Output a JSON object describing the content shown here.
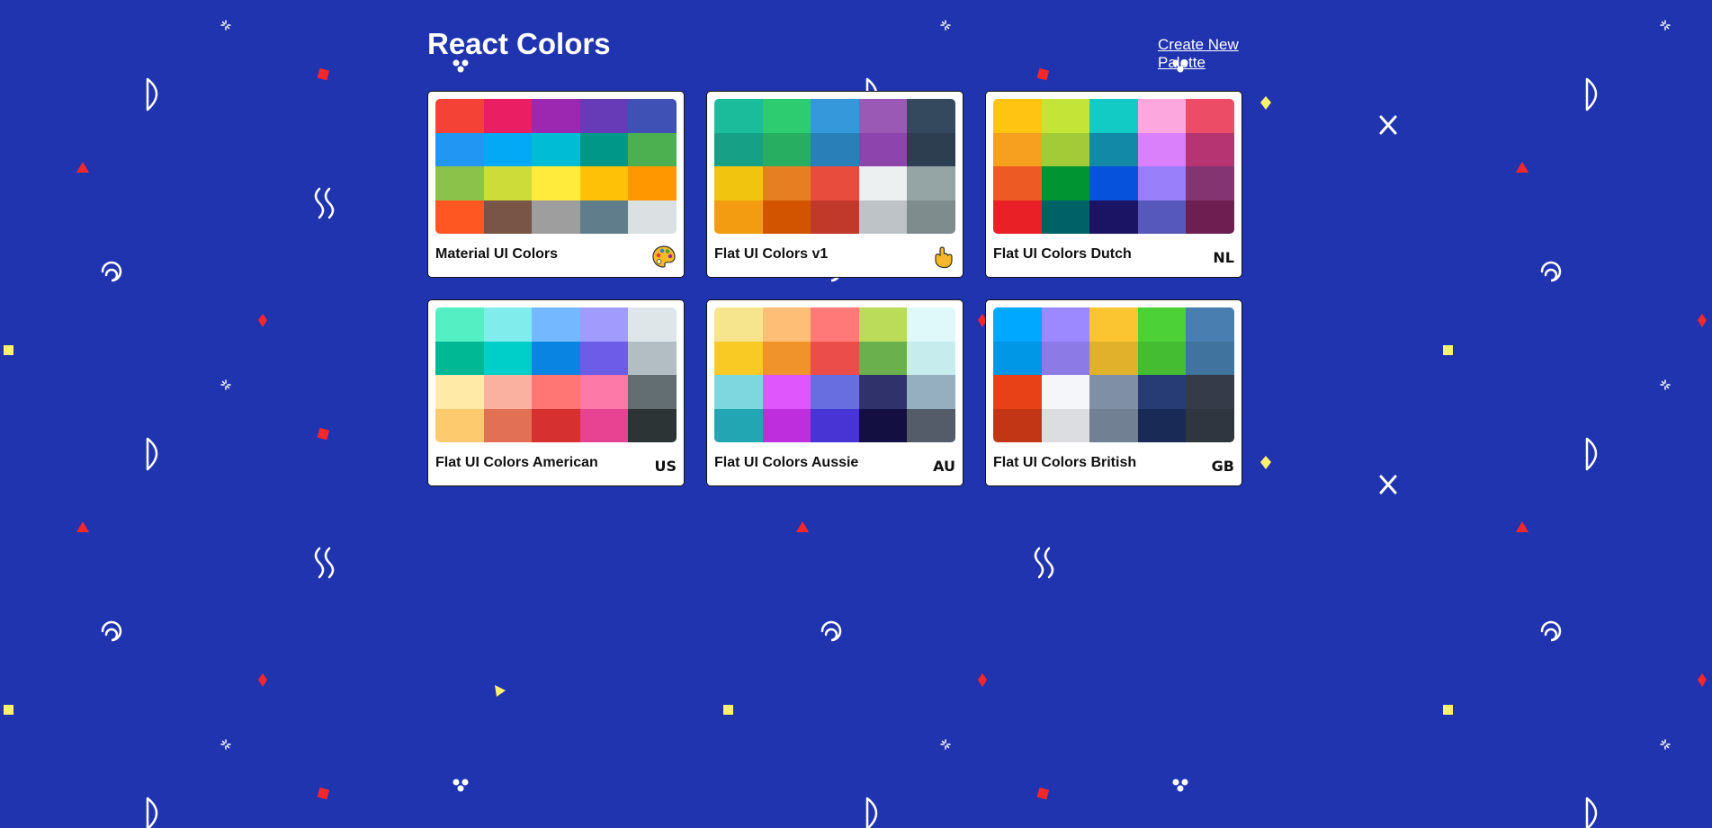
{
  "header": {
    "title": "React Colors",
    "create_link": "Create New Palette"
  },
  "theme": {
    "background": "#2034b0",
    "pattern_white": "#ffffff",
    "pattern_red": "#f4272b",
    "pattern_yellow": "#fef16d"
  },
  "palettes": [
    {
      "name": "Material UI Colors",
      "emoji_kind": "palette-icon",
      "emoji_text": "",
      "colors": [
        "#f44336",
        "#e91e63",
        "#9c27b0",
        "#673ab7",
        "#3f51b5",
        "#2196f3",
        "#03a9f4",
        "#00bcd4",
        "#009688",
        "#4caf50",
        "#8bc34a",
        "#cddc39",
        "#ffeb3b",
        "#ffc107",
        "#ff9800",
        "#ff5722",
        "#795548",
        "#9e9e9e",
        "#607d8b",
        "#dbe0e3"
      ]
    },
    {
      "name": "Flat UI Colors v1",
      "emoji_kind": "hand-icon",
      "emoji_text": "",
      "colors": [
        "#1abc9c",
        "#2ecc71",
        "#3498db",
        "#9b59b6",
        "#34495e",
        "#16a085",
        "#27ae60",
        "#2980b9",
        "#8e44ad",
        "#2c3e50",
        "#f1c40f",
        "#e67e22",
        "#e74c3c",
        "#ecf0f1",
        "#95a5a6",
        "#f39c12",
        "#d35400",
        "#c0392b",
        "#bdc3c7",
        "#7f8c8d"
      ]
    },
    {
      "name": "Flat UI Colors Dutch",
      "emoji_kind": "flag-code",
      "emoji_text": "NL",
      "colors": [
        "#ffc312",
        "#c4e538",
        "#12cbc4",
        "#fda7df",
        "#ed4c67",
        "#f79f1f",
        "#a3cb38",
        "#1289a7",
        "#d980fa",
        "#b53471",
        "#ee5a24",
        "#009432",
        "#0652dd",
        "#9980fa",
        "#833471",
        "#ea2027",
        "#006266",
        "#1b1464",
        "#5758bb",
        "#6f1e51"
      ]
    },
    {
      "name": "Flat UI Colors American",
      "emoji_kind": "flag-code",
      "emoji_text": "US",
      "colors": [
        "#55efc4",
        "#81ecec",
        "#74b9ff",
        "#a29bfe",
        "#dfe6e9",
        "#00b894",
        "#00cec9",
        "#0984e3",
        "#6c5ce7",
        "#b2bec3",
        "#ffeaa7",
        "#fab1a0",
        "#ff7675",
        "#fd79a8",
        "#636e72",
        "#fdcb6e",
        "#e17055",
        "#d63031",
        "#e84393",
        "#2d3436"
      ]
    },
    {
      "name": "Flat UI Colors Aussie",
      "emoji_kind": "flag-code",
      "emoji_text": "AU",
      "colors": [
        "#f6e58d",
        "#ffbe76",
        "#ff7979",
        "#badc58",
        "#dff9fb",
        "#f9ca24",
        "#f0932b",
        "#eb4d4b",
        "#6ab04c",
        "#c7ecee",
        "#7ed6df",
        "#e056fd",
        "#686de0",
        "#30336b",
        "#95afc0",
        "#22a6b3",
        "#be2edd",
        "#4834d4",
        "#130f40",
        "#535c68"
      ]
    },
    {
      "name": "Flat UI Colors British",
      "emoji_kind": "flag-code",
      "emoji_text": "GB",
      "colors": [
        "#00a8ff",
        "#9c88ff",
        "#fbc531",
        "#4cd137",
        "#487eb0",
        "#0097e6",
        "#8c7ae6",
        "#e1b12c",
        "#44bd32",
        "#40739e",
        "#e84118",
        "#f5f6fa",
        "#7f8fa6",
        "#273c75",
        "#353b48",
        "#c23616",
        "#dcdde1",
        "#718093",
        "#192a56",
        "#2f3640"
      ]
    }
  ]
}
